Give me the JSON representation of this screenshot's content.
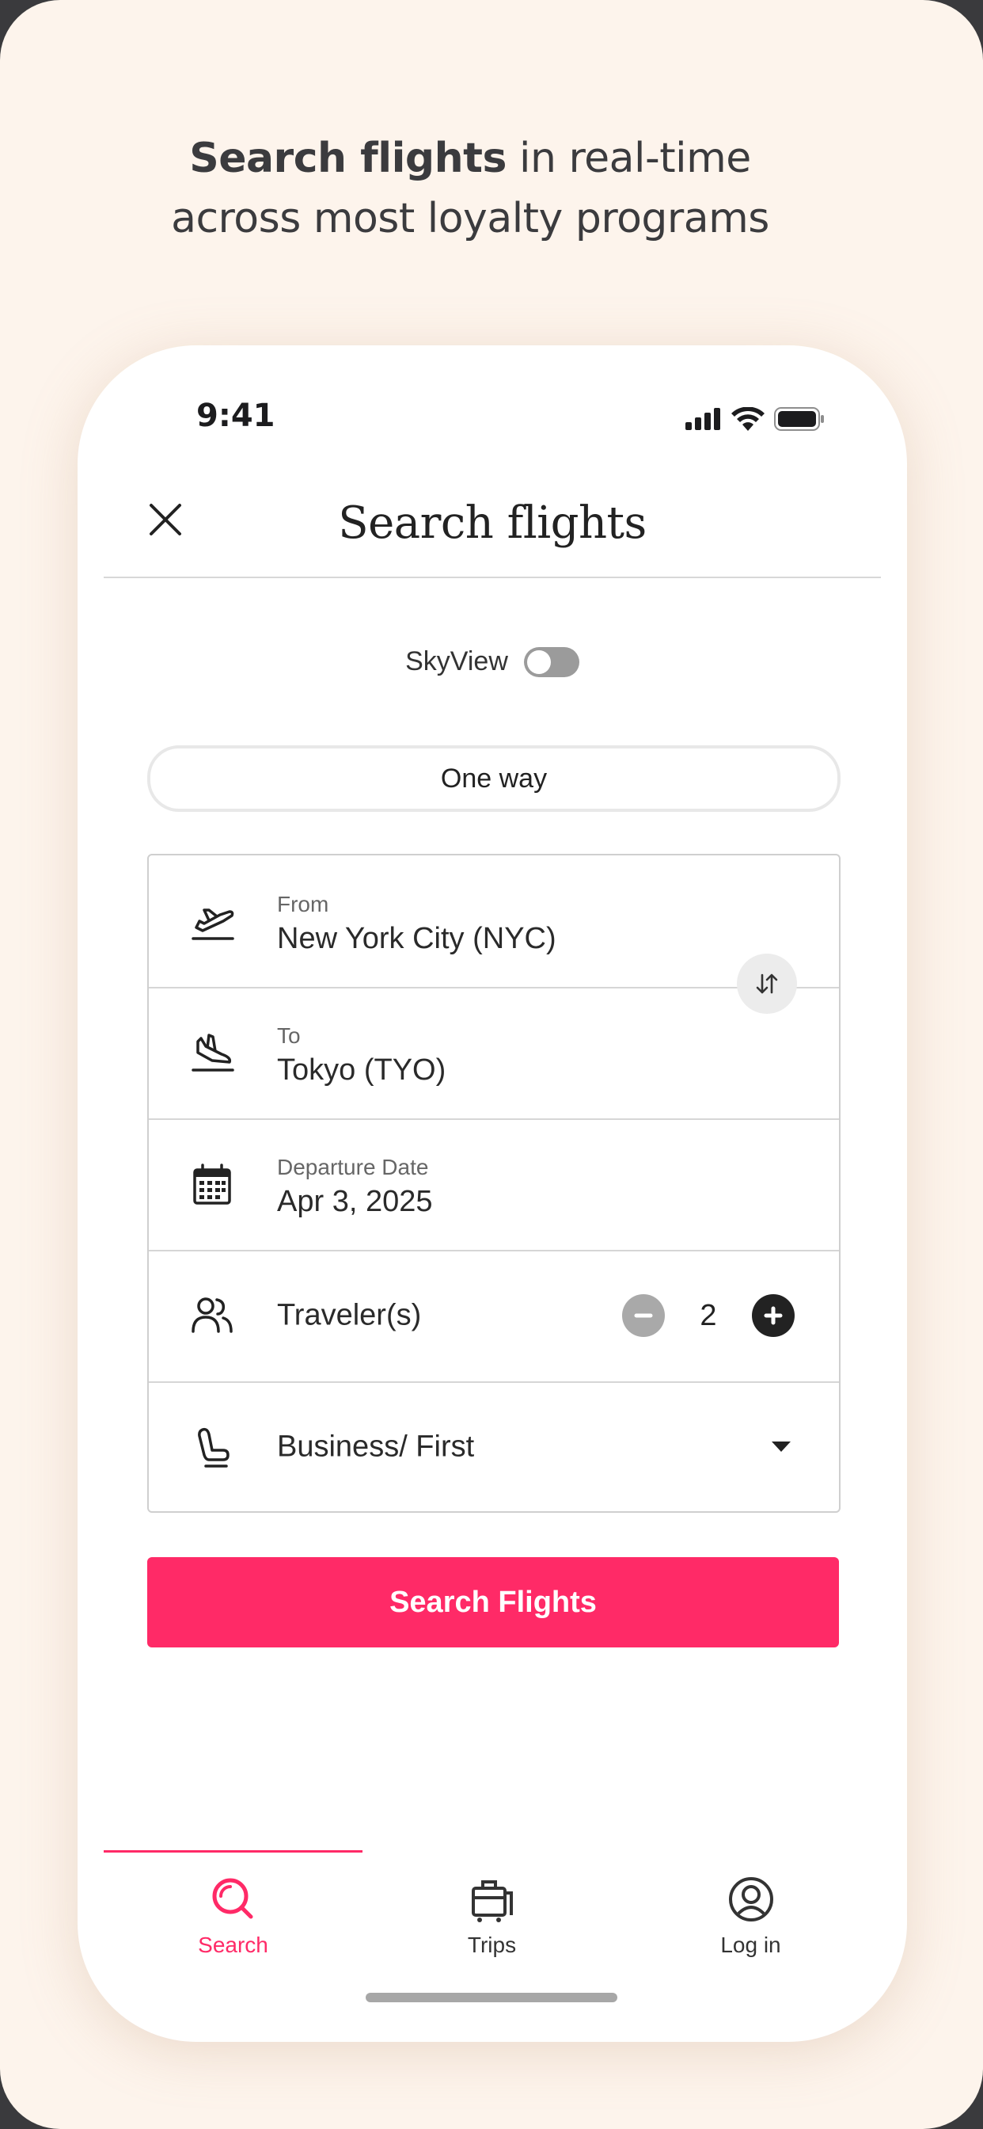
{
  "headline": {
    "bold": "Search flights",
    "rest_line1": " in real-time",
    "line2": "across most loyalty programs"
  },
  "status_bar": {
    "time": "9:41"
  },
  "header": {
    "title": "Search flights",
    "close_icon": "close-icon"
  },
  "skyview": {
    "label": "SkyView",
    "enabled": false
  },
  "trip_type": {
    "label": "One way"
  },
  "form": {
    "from": {
      "label": "From",
      "value": "New York City (NYC)",
      "icon": "takeoff-icon"
    },
    "to": {
      "label": "To",
      "value": "Tokyo (TYO)",
      "icon": "landing-icon"
    },
    "departure": {
      "label": "Departure Date",
      "value": "Apr 3, 2025",
      "icon": "calendar-icon"
    },
    "travelers": {
      "label": "Traveler(s)",
      "count": "2",
      "icon": "travelers-icon"
    },
    "cabin": {
      "value": "Business/ First",
      "icon": "seat-icon"
    }
  },
  "search_button": {
    "label": "Search Flights"
  },
  "tabs": [
    {
      "label": "Search",
      "icon": "search-icon",
      "active": true
    },
    {
      "label": "Trips",
      "icon": "luggage-icon",
      "active": false
    },
    {
      "label": "Log in",
      "icon": "user-icon",
      "active": false
    }
  ],
  "colors": {
    "accent": "#ff2a67",
    "background": "#fdf4ec",
    "text": "#2a2a2a"
  }
}
